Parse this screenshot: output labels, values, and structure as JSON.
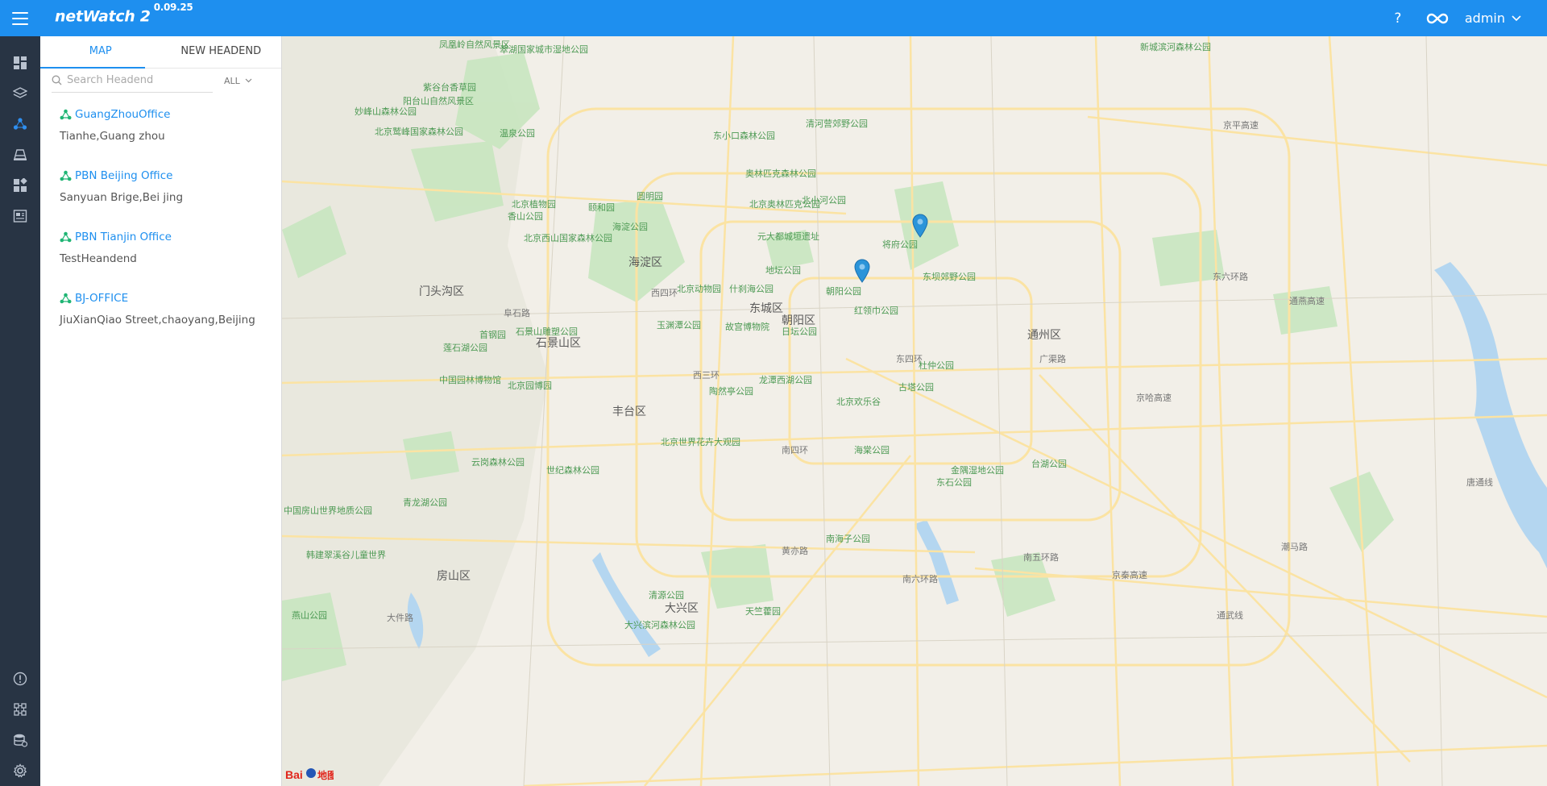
{
  "app": {
    "title": "netWatch 2",
    "version": "0.09.25"
  },
  "topbar": {
    "help_label": "?",
    "user": "admin"
  },
  "rail": {
    "items": [
      "dashboard",
      "layers",
      "topology",
      "devices",
      "apps",
      "monitor"
    ],
    "bottom": [
      "alarm",
      "network",
      "storage",
      "settings"
    ]
  },
  "tabs": [
    {
      "label": "MAP",
      "active": true
    },
    {
      "label": "NEW HEADEND",
      "active": false
    }
  ],
  "search": {
    "placeholder": "Search Headend",
    "filter": "ALL"
  },
  "headends": [
    {
      "name": "GuangZhouOffice",
      "location": "Tianhe,Guang zhou"
    },
    {
      "name": "PBN Beijing Office",
      "location": "Sanyuan Brige,Bei jing"
    },
    {
      "name": "PBN Tianjin Office",
      "location": "TestHeandend"
    },
    {
      "name": "BJ-OFFICE",
      "location": "JiuXianQiao Street,chaoyang,Beijing"
    }
  ],
  "map": {
    "districts": [
      "海淀区",
      "门头沟区",
      "石景山区",
      "丰台区",
      "东城区",
      "朝阳区",
      "通州区",
      "房山区",
      "大兴区"
    ],
    "parks": [
      "凤凰岭自然风景区",
      "翠湖国家城市湿地公园",
      "紫谷台香草园",
      "阳台山自然风景区",
      "妙峰山森林公园",
      "北京鹫峰国家森林公园",
      "温泉公园",
      "东小口森林公园",
      "清河营郊野公园",
      "新城滨河森林公园",
      "奥林匹克森林公园",
      "北京植物园",
      "香山公园",
      "颐和园",
      "圆明园",
      "北京奥林匹克公园",
      "北小河公园",
      "北京西山国家森林公园",
      "海淀公园",
      "元大都城垣遗址",
      "地坛公园",
      "将府公园",
      "北京动物园",
      "什刹海公园",
      "朝阳公园",
      "东坝郊野公园",
      "玉渊潭公园",
      "故宫博物院",
      "日坛公园",
      "红领巾公园",
      "莲石湖公园",
      "石景山雕塑公园",
      "首钢园",
      "中国园林博物馆",
      "北京园博园",
      "陶然亭公园",
      "龙潭西湖公园",
      "杜仲公园",
      "古塔公园",
      "北京欢乐谷",
      "北京世界花卉大观园",
      "世纪森林公园",
      "云岗森林公园",
      "海棠公园",
      "金隅湿地公园",
      "东石公园",
      "台湖公园",
      "南海子公园",
      "清源公园",
      "大兴滨河森林公园",
      "天竺藿园",
      "青龙湖公园",
      "中国房山世界地质公园",
      "韩建翠溪谷儿童世界",
      "燕山公园"
    ],
    "roads": [
      "京平高速",
      "东六环路",
      "通燕高速",
      "广渠路",
      "京哈高速",
      "南四环",
      "黄亦路",
      "南六环路",
      "南五环路",
      "大件路",
      "阜石路",
      "西四环",
      "西三环",
      "东四环",
      "京秦高速",
      "通武线",
      "潮马路",
      "唐通线"
    ],
    "pins": [
      {
        "name": "PBN Beijing Office"
      },
      {
        "name": "BJ-OFFICE"
      }
    ],
    "logo": "Bai du 地图"
  },
  "colors": {
    "primary": "#1e8fef",
    "rail": "#283444",
    "map_bg": "#f2efe8",
    "park": "#c8e6c0",
    "road": "#fbe3a3",
    "water": "#b4d6f0",
    "pin": "#2b94d9",
    "headend_icon": "#1fb574"
  }
}
